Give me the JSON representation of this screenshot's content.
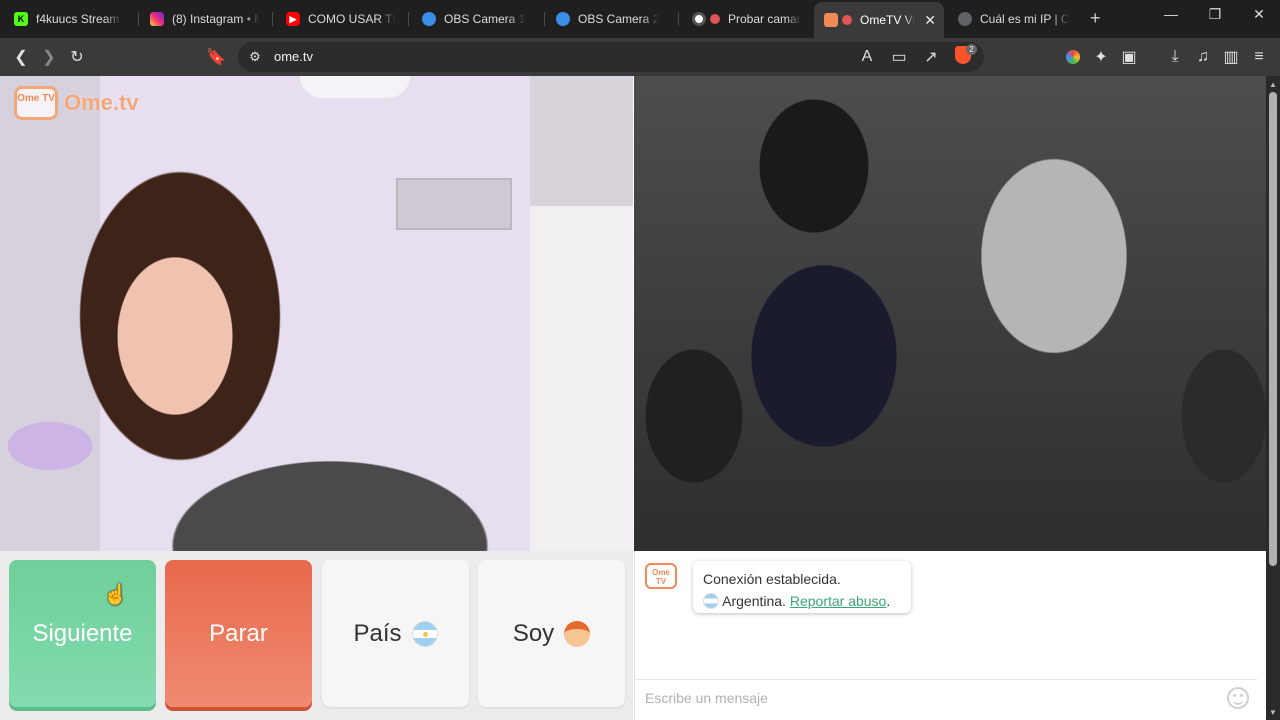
{
  "browser": {
    "tabs": [
      {
        "title": "f4kuucs Stream - ",
        "icon": "kick-icon",
        "color": "#53fc18"
      },
      {
        "title": "(8) Instagram • M",
        "icon": "instagram-icon",
        "color": "#d6249f"
      },
      {
        "title": "COMO USAR TU C",
        "icon": "youtube-icon",
        "color": "#ff0000"
      },
      {
        "title": "OBS Camera 1",
        "icon": "obs-camera-icon",
        "color": "#3b8ee8"
      },
      {
        "title": "OBS Camera 2",
        "icon": "obs-camera-icon",
        "color": "#3b8ee8"
      },
      {
        "title": "Probar camar",
        "icon": "camera-test-icon",
        "color": "#e05555"
      },
      {
        "title": "OmeTV Vi",
        "icon": "ometv-icon",
        "color": "#f08a56",
        "active": true
      },
      {
        "title": "Cuál es mi IP | Có",
        "icon": "globe-icon",
        "color": "#9aa0a6"
      }
    ],
    "url": "ome.tv",
    "brave_badge": "2"
  },
  "site": {
    "logo_tv": "Ome TV",
    "logo_text": "Ome.tv"
  },
  "controls": {
    "next_label": "Siguiente",
    "stop_label": "Parar",
    "country_label": "País",
    "gender_label": "Soy"
  },
  "chat": {
    "logo_tv": "Ome TV",
    "status": "Conexión establecida.",
    "country": "Argentina.",
    "report_link": "Reportar abuso",
    "report_suffix": ".",
    "input_placeholder": "Escribe un mensaje"
  },
  "colors": {
    "next": "#6fcf9a",
    "stop": "#e8694d",
    "brand": "#f08a56",
    "link": "#3aa776"
  }
}
